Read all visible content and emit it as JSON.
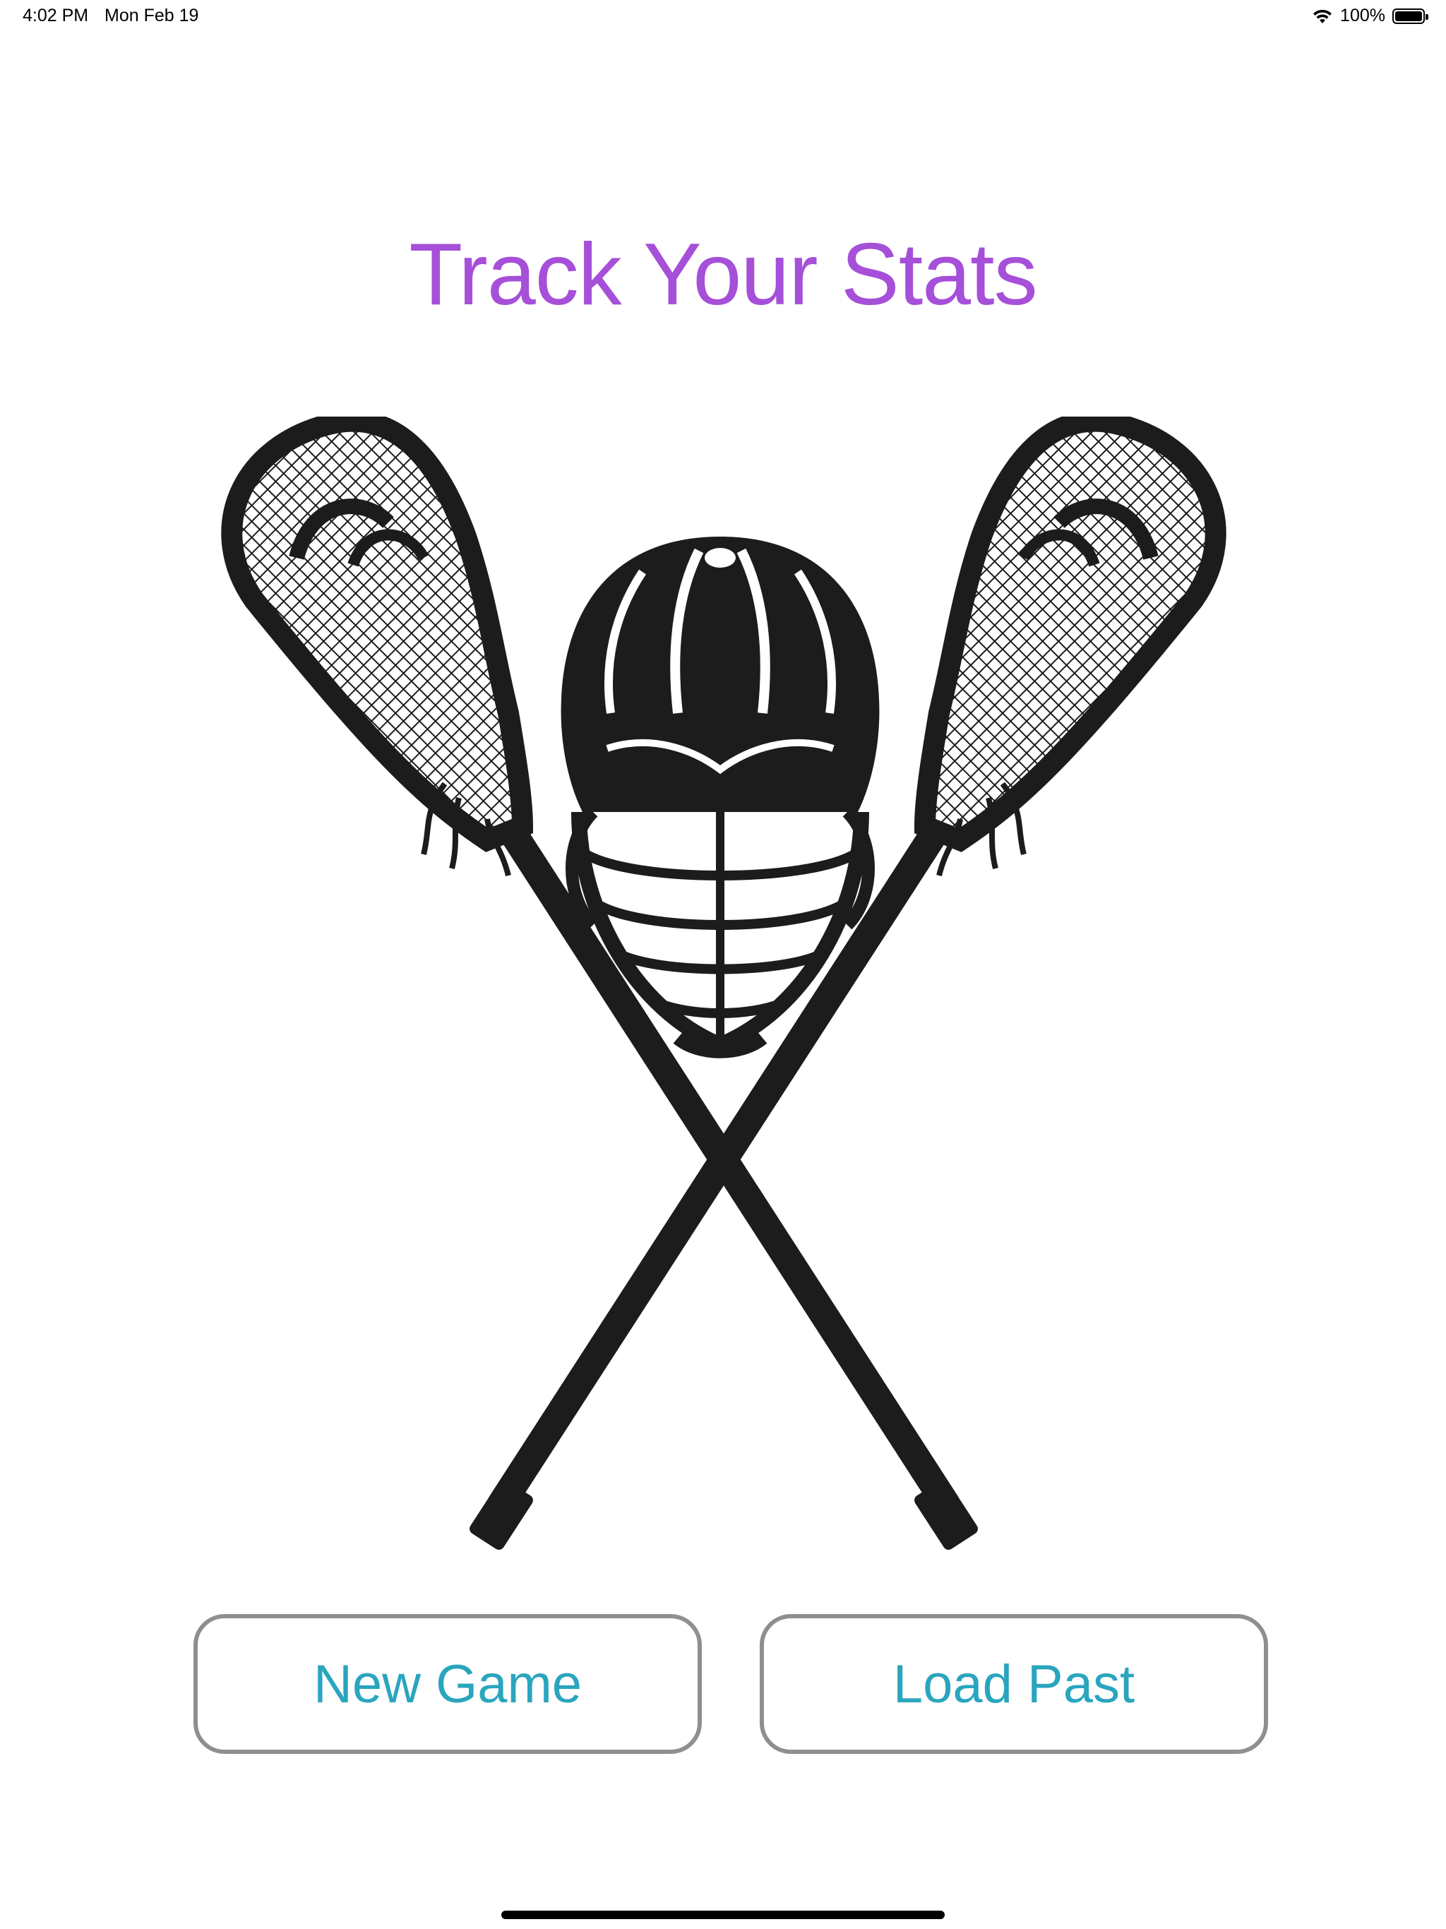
{
  "status_bar": {
    "time": "4:02 PM",
    "date": "Mon Feb 19",
    "battery_text": "100%",
    "battery_level": 1.0,
    "icons": [
      "wifi-icon",
      "battery-icon"
    ]
  },
  "main": {
    "title": "Track Your Stats",
    "logo_icon": "lacrosse-sticks-helmet-icon",
    "buttons": {
      "new_game": "New Game",
      "load_past": "Load Past"
    }
  },
  "colors": {
    "title": "#a64fd8",
    "button_text": "#2aa5be",
    "button_border": "#8e8e93",
    "logo": "#1c1c1c"
  }
}
